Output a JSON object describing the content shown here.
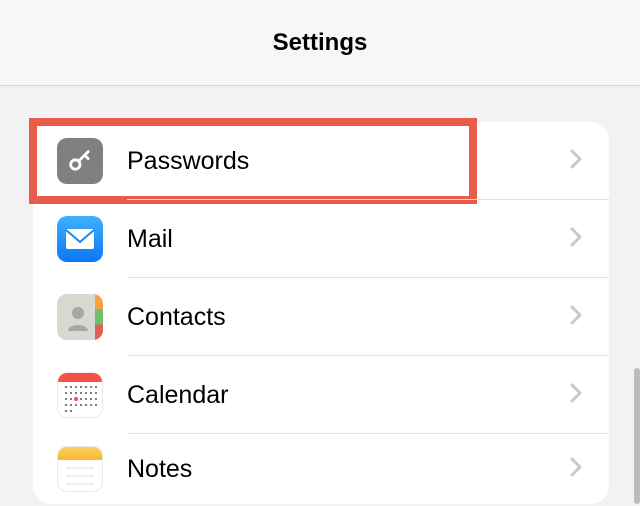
{
  "header": {
    "title": "Settings"
  },
  "rows": [
    {
      "label": "Passwords"
    },
    {
      "label": "Mail"
    },
    {
      "label": "Contacts"
    },
    {
      "label": "Calendar"
    },
    {
      "label": "Notes"
    }
  ]
}
